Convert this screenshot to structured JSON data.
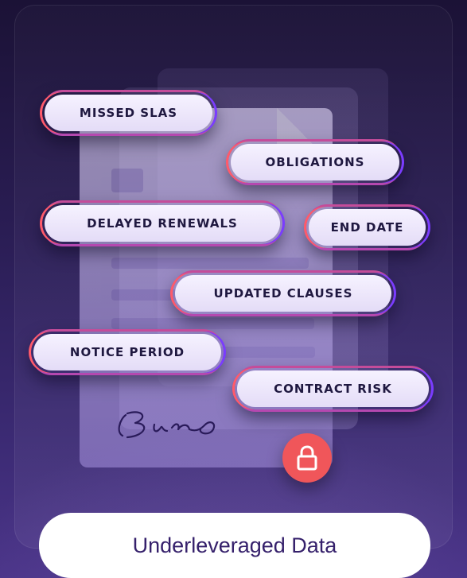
{
  "tags": {
    "missed_slas": "MISSED SLAS",
    "obligations": "OBLIGATIONS",
    "delayed_renewals": "DELAYED RENEWALS",
    "end_date": "END DATE",
    "updated_clauses": "UPDATED CLAUSES",
    "notice_period": "NOTICE PERIOD",
    "contract_risk": "CONTRACT RISK"
  },
  "signature": "Bun",
  "footer": {
    "label": "Underleveraged Data"
  },
  "colors": {
    "accent_red": "#f0565a",
    "accent_purple": "#7a3cff",
    "pill_text": "#35206b"
  },
  "icons": {
    "lock": "lock-icon"
  }
}
